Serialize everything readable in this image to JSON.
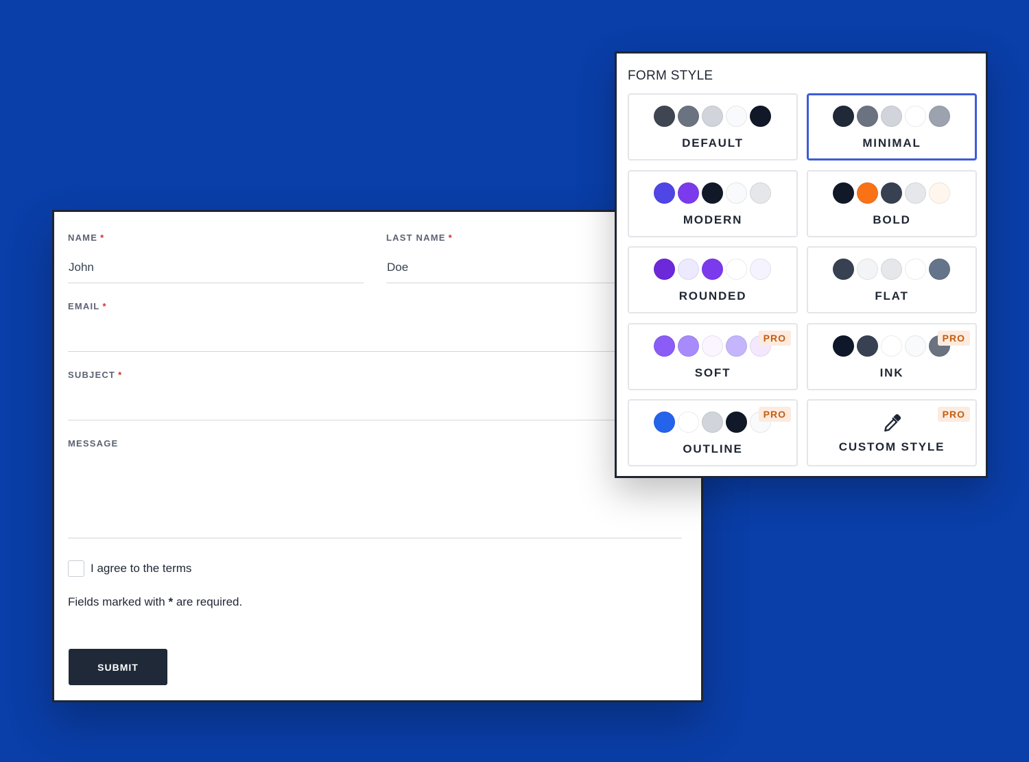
{
  "form": {
    "name_label": "NAME",
    "name_value": "John",
    "lastname_label": "LAST NAME",
    "lastname_value": "Doe",
    "email_label": "EMAIL",
    "email_value": "",
    "subject_label": "SUBJECT",
    "subject_value": "",
    "message_label": "MESSAGE",
    "message_value": "",
    "required_mark": "*",
    "agree_label": "I agree to the terms",
    "required_note_prefix": "Fields marked with",
    "required_note_mark": "*",
    "required_note_suffix": "are required.",
    "submit_label": "SUBMIT"
  },
  "panel": {
    "title": "FORM STYLE",
    "pro_badge": "PRO",
    "styles": [
      {
        "label": "DEFAULT",
        "selected": false,
        "pro": false,
        "swatches": [
          "#3f4551",
          "#6b7280",
          "#d1d5db",
          "#f9fafb",
          "#111827"
        ]
      },
      {
        "label": "MINIMAL",
        "selected": true,
        "pro": false,
        "swatches": [
          "#1f2937",
          "#6b7280",
          "#d1d5db",
          "#ffffff",
          "#9ca3af"
        ]
      },
      {
        "label": "MODERN",
        "selected": false,
        "pro": false,
        "swatches": [
          "#4f46e5",
          "#7c3aed",
          "#111827",
          "#f9fafb",
          "#e5e7eb"
        ]
      },
      {
        "label": "BOLD",
        "selected": false,
        "pro": false,
        "swatches": [
          "#111827",
          "#f97316",
          "#374151",
          "#e5e7eb",
          "#fff7ed"
        ]
      },
      {
        "label": "ROUNDED",
        "selected": false,
        "pro": false,
        "swatches": [
          "#6d28d9",
          "#ede9fe",
          "#7c3aed",
          "#ffffff",
          "#f5f3ff"
        ]
      },
      {
        "label": "FLAT",
        "selected": false,
        "pro": false,
        "swatches": [
          "#374151",
          "#f3f4f6",
          "#e5e7eb",
          "#ffffff",
          "#64748b"
        ]
      },
      {
        "label": "SOFT",
        "selected": false,
        "pro": true,
        "swatches": [
          "#8b5cf6",
          "#a78bfa",
          "#faf5ff",
          "#c4b5fd",
          "#f3e8ff"
        ]
      },
      {
        "label": "INK",
        "selected": false,
        "pro": true,
        "swatches": [
          "#0f172a",
          "#374151",
          "#ffffff",
          "#f9fafb",
          "#6b7280"
        ]
      },
      {
        "label": "OUTLINE",
        "selected": false,
        "pro": true,
        "swatches": [
          "#2563eb",
          "#ffffff",
          "#d1d5db",
          "#111827",
          "#f9fafb"
        ]
      },
      {
        "label": "CUSTOM STYLE",
        "selected": false,
        "pro": true,
        "icon": "color-picker-icon"
      }
    ]
  }
}
